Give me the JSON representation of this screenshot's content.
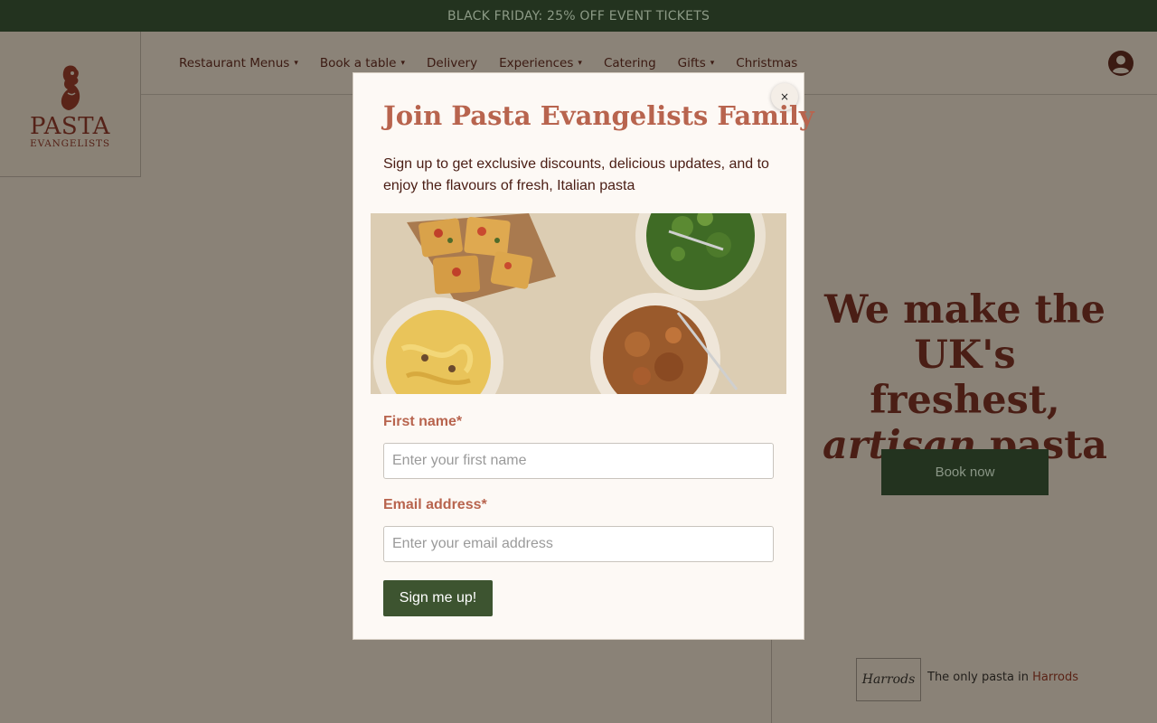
{
  "banner": {
    "text": "BLACK FRIDAY: 25% OFF EVENT TICKETS"
  },
  "logo": {
    "word": "PASTA",
    "sub": "EVANGELISTS"
  },
  "nav": {
    "items": [
      {
        "label": "Restaurant Menus",
        "has_caret": true
      },
      {
        "label": "Book a table",
        "has_caret": true
      },
      {
        "label": "Delivery",
        "has_caret": false
      },
      {
        "label": "Experiences",
        "has_caret": true
      },
      {
        "label": "Catering",
        "has_caret": false
      },
      {
        "label": "Gifts",
        "has_caret": true
      },
      {
        "label": "Christmas",
        "has_caret": false
      }
    ],
    "caret_glyph": "▾",
    "account_icon": "user-circle-icon"
  },
  "hero": {
    "title_line1": "We make the",
    "title_line2": "UK's freshest,",
    "title_em": "artisan",
    "title_end": " pasta",
    "book_label": "Book now",
    "harrods_logo": "Harrods",
    "harrods_text": "The only pasta in ",
    "harrods_link": "Harrods"
  },
  "modal": {
    "close_glyph": "×",
    "title": "Join Pasta Evangelists Family",
    "description": "Sign up to get exclusive discounts, delicious updates, and to enjoy the flavours of fresh, Italian pasta",
    "first_name_label": "First name*",
    "first_name_placeholder": "Enter your first name",
    "first_name_value": "",
    "email_label": "Email address*",
    "email_placeholder": "Enter your email address",
    "email_value": "",
    "submit_label": "Sign me up!"
  },
  "colors": {
    "brand_dark_green": "#23331f",
    "brand_red": "#b8644e",
    "button_green": "#3d5430",
    "modal_bg": "#fdf9f5"
  }
}
